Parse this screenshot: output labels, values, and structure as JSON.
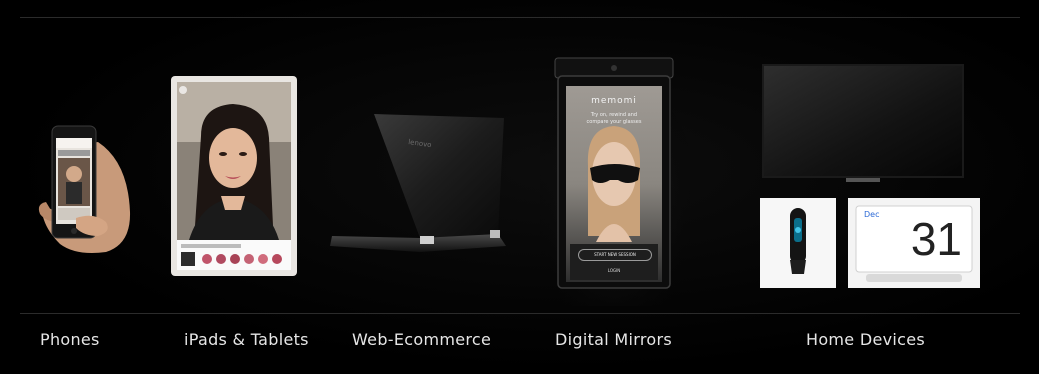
{
  "categories": {
    "phones": "Phones",
    "tablets": "iPads & Tablets",
    "web": "Web-Ecommerce",
    "mirrors": "Digital Mirrors",
    "home": "Home Devices"
  },
  "mirror_screen": {
    "brand": "memomi",
    "tagline_1": "Try on, rewind and",
    "tagline_2": "compare your glasses",
    "start_button": "START NEW SESSION",
    "login": "LOGIN"
  },
  "laptop_brand": "lenovo",
  "calendar": {
    "month": "Dec",
    "day": "31"
  },
  "colors": {
    "background": "#000000",
    "label_text": "#e6e6e6",
    "divider": "#2b2b2b"
  }
}
